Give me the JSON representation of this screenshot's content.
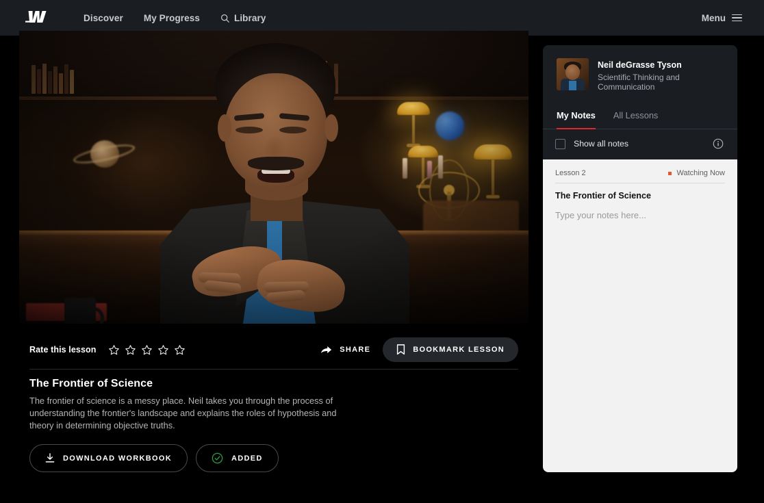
{
  "nav": {
    "logo_name": "masterclass-logo",
    "links": [
      {
        "label": "Discover",
        "icon": ""
      },
      {
        "label": "My Progress",
        "icon": ""
      },
      {
        "label": "Library",
        "icon": "search-icon"
      }
    ],
    "menu_label": "Menu"
  },
  "video": {
    "alt": "Neil deGrasse Tyson speaking in a library study with banker's lamps and a Saturn model"
  },
  "rating": {
    "label": "Rate this lesson",
    "stars_total": 5,
    "stars_filled": 0
  },
  "actions": {
    "share_label": "SHARE",
    "bookmark_label": "BOOKMARK LESSON",
    "download_label": "DOWNLOAD WORKBOOK",
    "added_label": "ADDED"
  },
  "lesson": {
    "title": "The Frontier of Science",
    "description": "The frontier of science is a messy place. Neil takes you through the process of understanding the frontier's landscape and explains the roles of hypothesis and theory in determining objective truths."
  },
  "notes": {
    "instructor_name": "Neil deGrasse Tyson",
    "course_name": "Scientific Thinking and Communication",
    "tabs": [
      {
        "label": "My Notes",
        "active": true
      },
      {
        "label": "All Lessons",
        "active": false
      }
    ],
    "show_all_label": "Show all notes",
    "show_all_checked": false,
    "lesson_number": "Lesson 2",
    "status": "Watching Now",
    "note_lesson_title": "The Frontier of Science",
    "placeholder": "Type your notes here...",
    "note_value": ""
  },
  "colors": {
    "accent_red": "#e2272f",
    "status_orange": "#e2582c",
    "added_green": "#2f9e44",
    "nav_bg": "#1a1d22",
    "panel_bg": "#1a1d22",
    "notes_bg": "#f2f2f2"
  }
}
